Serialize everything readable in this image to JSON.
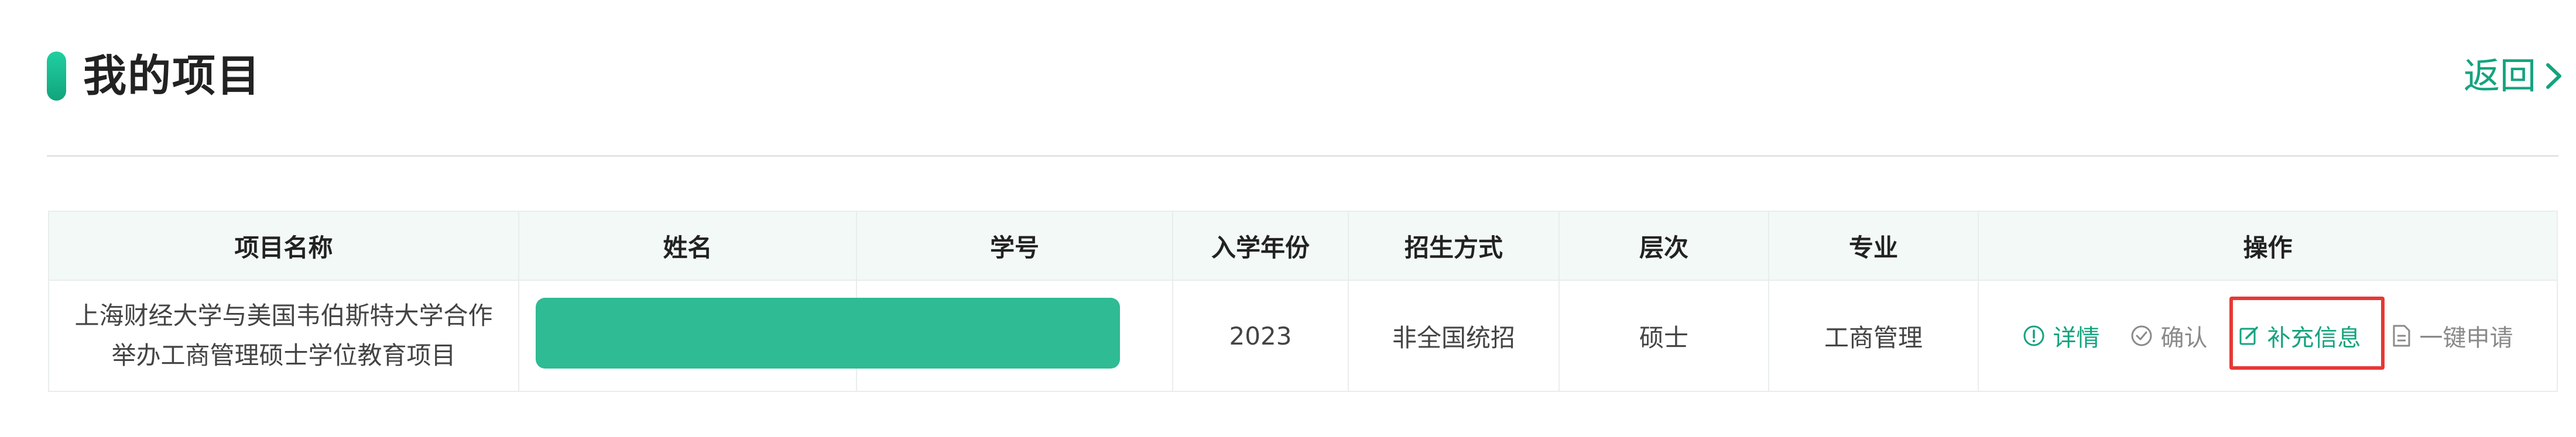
{
  "page": {
    "title": "我的项目",
    "back_label": "返回"
  },
  "table": {
    "headers": [
      "项目名称",
      "姓名",
      "学号",
      "入学年份",
      "招生方式",
      "层次",
      "专业",
      "操作"
    ],
    "rows": [
      {
        "project_name": "上海财经大学与美国韦伯斯特大学合作举办工商管理硕士学位教育项目",
        "name": "",
        "student_id": "",
        "year": "2023",
        "enrollment_method": "非全国统招",
        "level": "硕士",
        "major": "工商管理",
        "actions": {
          "details": "详情",
          "confirm": "确认",
          "supplement": "补充信息",
          "apply": "一键申请"
        }
      }
    ]
  },
  "colors": {
    "accent": "#14a37f",
    "mask": "#2fbb94",
    "highlight": "#e53935"
  }
}
